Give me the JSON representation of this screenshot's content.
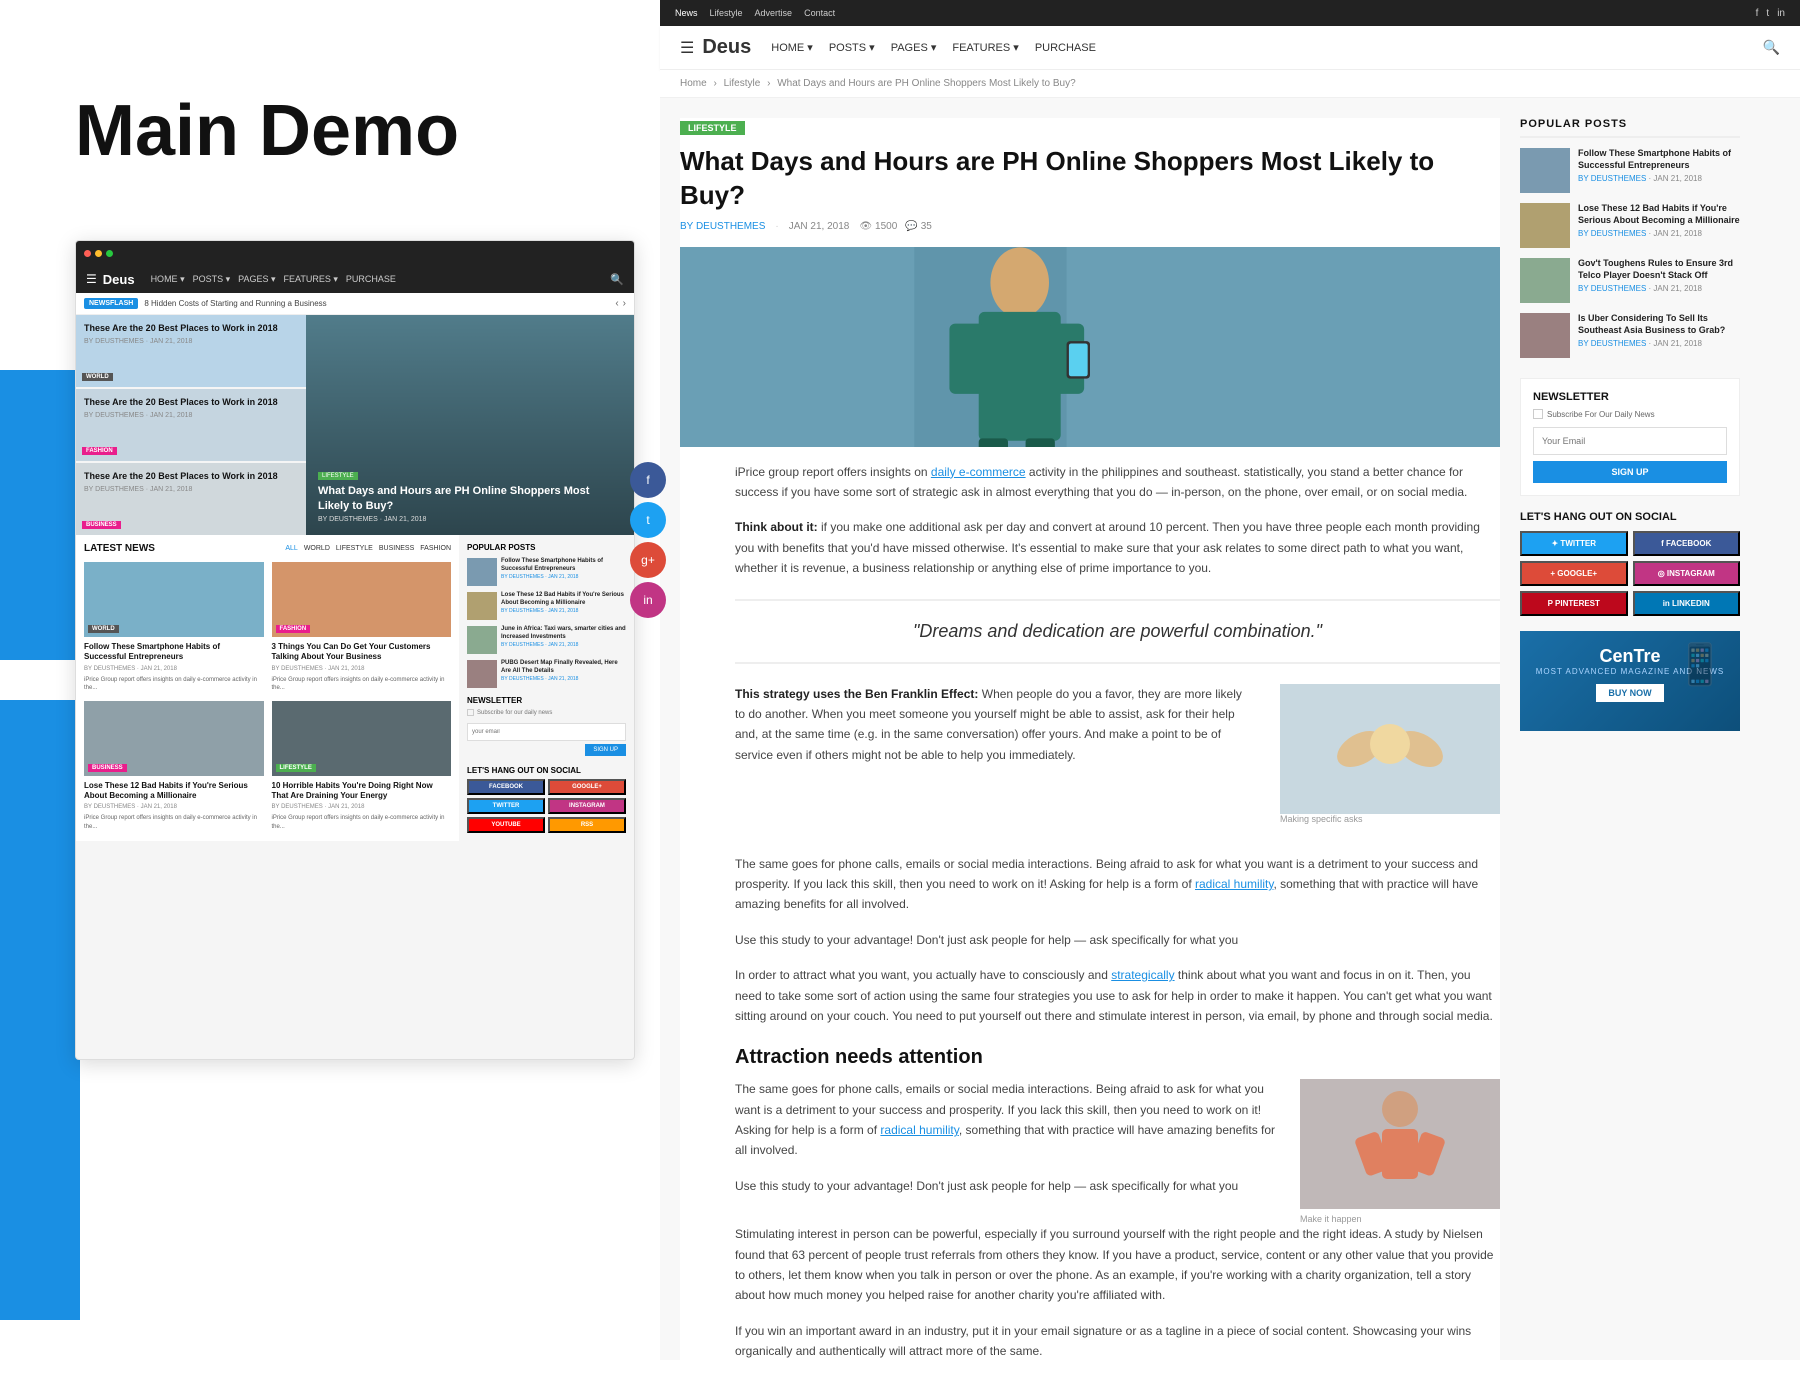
{
  "left": {
    "demo_title": "Main Demo",
    "browser": {
      "navbar": {
        "logo": "Deus",
        "nav_items": [
          "HOME ▾",
          "POSTS ▾",
          "PAGES ▾",
          "FEATURES ▾",
          "PURCHASE"
        ]
      },
      "newsflash": {
        "badge": "NEWSFLASH",
        "text": "8 Hidden Costs of Starting and Running a Business"
      },
      "hero_cards": [
        {
          "title": "These Are the 20 Best Places to Work in 2018",
          "by": "BY DEUSTHEMES · JAN 21, 2018",
          "tag": "WORLD",
          "tag_class": "tag-world"
        },
        {
          "title": "These Are the 20 Best Places to Work in 2018",
          "by": "BY DEUSTHEMES · JAN 21, 2018",
          "tag": "FASHION",
          "tag_class": "tag-fashion"
        },
        {
          "title": "These Are the 20 Best Places to Work in 2018",
          "by": "BY DEUSTHEMES · JAN 21, 2018",
          "tag": "BUSINESS",
          "tag_class": "tag-business"
        }
      ],
      "hero_main": {
        "tag": "LIFESTYLE",
        "title": "What Days and Hours are PH Online Shoppers Most Likely to Buy?",
        "by": "BY DEUSTHEMES · JAN 21, 2018"
      },
      "latest_news": {
        "title": "LATEST NEWS",
        "filters": [
          "ALL",
          "WORLD",
          "LIFESTYLE",
          "BUSINESS",
          "FASHION"
        ],
        "cards": [
          {
            "title": "Follow These Smartphone Habits of Successful Entrepreneurs",
            "by": "BY DEUSTHEMES · JAN 21, 2018",
            "text": "iPrice Group report offers insights on daily e-commerce activity in the...",
            "tag": "WORLD",
            "img_class": "blue-img"
          },
          {
            "title": "3 Things You Can Do Get Your Customers Talking About Your Business",
            "by": "BY DEUSTHEMES · JAN 21, 2018",
            "text": "iPrice Group report offers insights on daily e-commerce activity in the...",
            "tag": "FASHION",
            "img_class": "orange-img"
          },
          {
            "title": "Lose These 12 Bad Habits if You're Serious About Becoming a Millionaire",
            "by": "BY DEUSTHEMES · JAN 21, 2018",
            "text": "iPrice Group report offers insights on daily e-commerce activity in the...",
            "tag": "BUSINESS",
            "img_class": "gray-img"
          },
          {
            "title": "10 Horrible Habits You're Doing Right Now That Are Draining Your Energy",
            "by": "BY DEUSTHEMES · JAN 21, 2018",
            "text": "iPrice Group report offers insights on daily e-commerce activity in the...",
            "tag": "LIFESTYLE",
            "img_class": "dark-img"
          }
        ]
      },
      "popular_posts": {
        "title": "POPULAR POSTS",
        "items": [
          {
            "title": "Follow These Smartphone Habits of Successful Entrepreneurs",
            "author": "BY DEUSTHEMES",
            "date": "· JAN 21, 2018",
            "img_class": "pi1"
          },
          {
            "title": "Lose These 12 Bad Habits if You're Serious About Becoming a Millionaire",
            "author": "BY DEUSTHEMES",
            "date": "· JAN 21, 2018",
            "img_class": "pi2"
          },
          {
            "title": "June in Africa: Taxi wars, smarter cities and Increased Investments",
            "author": "BY DEUSTHEMES",
            "date": "· JAN 21, 2018",
            "img_class": "pi3"
          },
          {
            "title": "PUBG Desert Map Finally Revealed, Here Are All The Details",
            "author": "BY DEUSTHEMES",
            "date": "· JAN 21, 2018",
            "img_class": "pi4"
          }
        ]
      },
      "newsletter": {
        "title": "NEWSLETTER",
        "checkbox_label": "Subscribe for our daily news",
        "input_placeholder": "your email",
        "btn_label": "SIGN UP"
      },
      "social": {
        "title": "LET'S HANG OUT ON SOCIAL",
        "buttons": [
          {
            "label": "FACEBOOK",
            "class": "bsb-facebook"
          },
          {
            "label": "GOOGLE+",
            "class": "bsb-googleplus"
          },
          {
            "label": "TWITTER",
            "class": "bsb-twitter"
          },
          {
            "label": "INSTAGRAM",
            "class": "bsb-instagram"
          },
          {
            "label": "YOUTUBE",
            "class": "bsb-youtube"
          },
          {
            "label": "RSS",
            "class": "bsb-rss"
          }
        ]
      }
    }
  },
  "right": {
    "top_nav": {
      "links": [
        "News",
        "Lifestyle",
        "Advertise",
        "Contact"
      ],
      "social_icons": [
        "f",
        "t",
        "in"
      ]
    },
    "main_nav": {
      "logo": "Deus",
      "items": [
        "HOME ▾",
        "POSTS ▾",
        "PAGES ▾",
        "FEATURES ▾",
        "PURCHASE"
      ]
    },
    "breadcrumb": {
      "home": "Home",
      "section": "Lifestyle",
      "current": "What Days and Hours are PH Online Shoppers Most Likely to Buy?"
    },
    "article": {
      "category": "LIFESTYLE",
      "title": "What Days and Hours are PH Online Shoppers Most Likely to Buy?",
      "author": "BY DEUSTHEMES",
      "date": "JAN 21, 2018",
      "views": "1500",
      "comments": "35",
      "body": [
        "iPrice group report offers insights on daily e-commerce activity in the philippines and southeast. statistically, you stand a better chance for success if you have some sort of strategic ask in almost everything that you do — in-person, on the phone, over email, or on social media.",
        "Think about it: if you make one additional ask per day and convert at around 10 percent. Then you have three people each month providing you with benefits that you'd have missed otherwise. It's essential to make sure that your ask relates to some direct path to what you want, whether it is revenue, a business relationship or anything else of prime importance to you."
      ],
      "quote": "\"Dreams and dedication are powerful combination.\"",
      "body2": [
        "This strategy uses the Ben Franklin Effect: When people do you a favor, they are more likely to do another. When you meet someone you yourself might be able to assist, ask for their help and, at the same time (e.g. in the same conversation) offer yours. And make a point to be of service even if others might not be able to help you immediately.",
        "The same goes for phone calls, emails or social media interactions. Being afraid to ask for what you want is a detriment to your success and prosperity. If you lack this skill, then you need to work on it! Asking for help is a form of radical humility, something that with practice will have amazing benefits for all involved.",
        "Use this study to your advantage! Don't just ask people for help — ask specifically for what you"
      ],
      "figure_caption": "Making specific asks",
      "body3": [
        "In order to attract what you want, you actually have to consciously and strategically think about what you want and focus in on it. Then, you need to take some sort of action using the same four strategies you use to ask for help in order to make it happen. You can't get what you want sitting around on your couch. You need to put yourself out there and stimulate interest in person, via email, by phone and through social media."
      ],
      "section2_title": "Attraction needs attention",
      "body4": [
        "The same goes for phone calls, emails or social media interactions. Being afraid to ask for what you want is a detriment to your success and prosperity. If you lack this skill, then you need to work on it! Asking for help is a form of radical humility, something that with practice will have amazing benefits for all involved.",
        "Use this study to your advantage! Don't just ask people for help — ask specifically for what you"
      ],
      "figure2_caption": "Make it happen",
      "body5": "Stimulating interest in person can be powerful, especially if you surround yourself with the right people and the right ideas. A study by Nielsen found that 63 percent of people trust referrals from others they know. If you have a product, service, content or any other value that you provide to others, let them know when you talk in person or over the phone. As an example, if you're working with a charity organization, tell a story about how much money you helped raise for another charity you're affiliated with.",
      "body6": "If you win an important award in an industry, put it in your email signature or as a tagline in a piece of social content. Showcasing your wins organically and authentically will attract more of the same."
    },
    "sidebar": {
      "popular_posts_title": "POPULAR POSTS",
      "popular_posts": [
        {
          "title": "Follow These Smartphone Habits of Successful Entrepreneurs",
          "author": "BY DEUSTHEMES",
          "date": "· JAN 21, 2018",
          "img_class": "img1"
        },
        {
          "title": "Lose These 12 Bad Habits if You're Serious About Becoming a Millionaire",
          "author": "BY DEUSTHEMES",
          "date": "· JAN 21, 2018",
          "img_class": "img2"
        },
        {
          "title": "Gov't Toughens Rules to Ensure 3rd Telco Player Doesn't Stack Off",
          "author": "BY DEUSTHEMES",
          "date": "· JAN 21, 2018",
          "img_class": "img3"
        },
        {
          "title": "Is Uber Considering To Sell Its Southeast Asia Business to Grab?",
          "author": "BY DEUSTHEMES",
          "date": "· JAN 21, 2018",
          "img_class": "img4"
        }
      ],
      "newsletter_title": "NEWSLETTER",
      "newsletter_checkbox": "Subscribe For Our Daily News",
      "newsletter_placeholder": "Your Email",
      "newsletter_btn": "SIGN UP",
      "social_title": "LET'S HANG OUT ON SOCIAL",
      "social_buttons": [
        {
          "label": "TWITTER",
          "class": "sh-twitter"
        },
        {
          "label": "FACEBOOK",
          "class": "sh-facebook"
        },
        {
          "label": "GOOGLE+",
          "class": "sh-googleplus"
        },
        {
          "label": "INSTAGRAM",
          "class": "sh-instagram"
        },
        {
          "label": "PINTEREST",
          "class": "sh-pinterest"
        },
        {
          "label": "LINKEDIN",
          "class": "sh-linkedin"
        }
      ],
      "ad_logo": "CenTre",
      "ad_sub": "MOST ADVANCED MAGAZINE AND NEWS",
      "ad_btn": "BUY NOW"
    }
  }
}
